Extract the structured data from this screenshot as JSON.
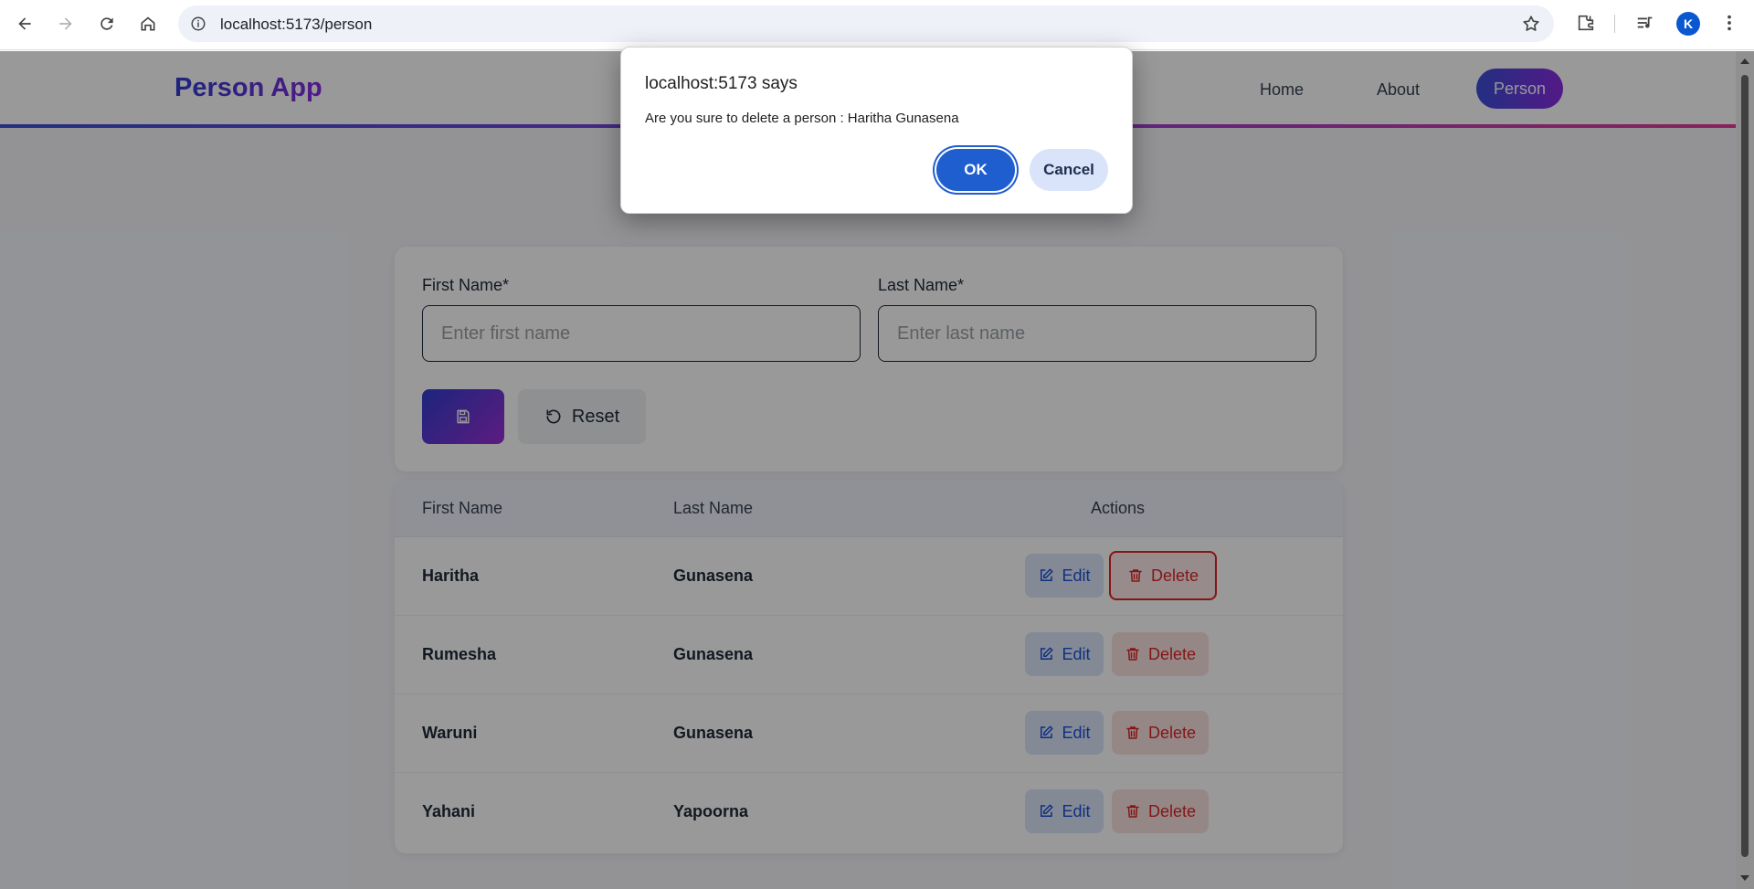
{
  "browser": {
    "url": "localhost:5173/person",
    "profile_initial": "K"
  },
  "app": {
    "brand": "Person App",
    "nav": {
      "home": "Home",
      "about": "About",
      "person": "Person"
    }
  },
  "form": {
    "first_name_label": "First Name*",
    "first_name_placeholder": "Enter first name",
    "last_name_label": "Last Name*",
    "last_name_placeholder": "Enter last name",
    "reset_label": "Reset"
  },
  "table": {
    "headers": {
      "first_name": "First Name",
      "last_name": "Last Name",
      "actions": "Actions"
    },
    "rows": [
      {
        "first": "Haritha",
        "last": "Gunasena"
      },
      {
        "first": "Rumesha",
        "last": "Gunasena"
      },
      {
        "first": "Waruni",
        "last": "Gunasena"
      },
      {
        "first": "Yahani",
        "last": "Yapoorna"
      }
    ],
    "edit_label": "Edit",
    "delete_label": "Delete"
  },
  "dialog": {
    "title": "localhost:5173 says",
    "message": "Are you sure to delete a person : Haritha Gunasena",
    "ok_label": "OK",
    "cancel_label": "Cancel"
  },
  "colors": {
    "brand_gradient_start": "#2f3ed0",
    "brand_gradient_end": "#8a2be2",
    "edit_text": "#1d4ed8",
    "delete_text": "#dc2626",
    "dialog_ok": "#1f5ecf"
  }
}
